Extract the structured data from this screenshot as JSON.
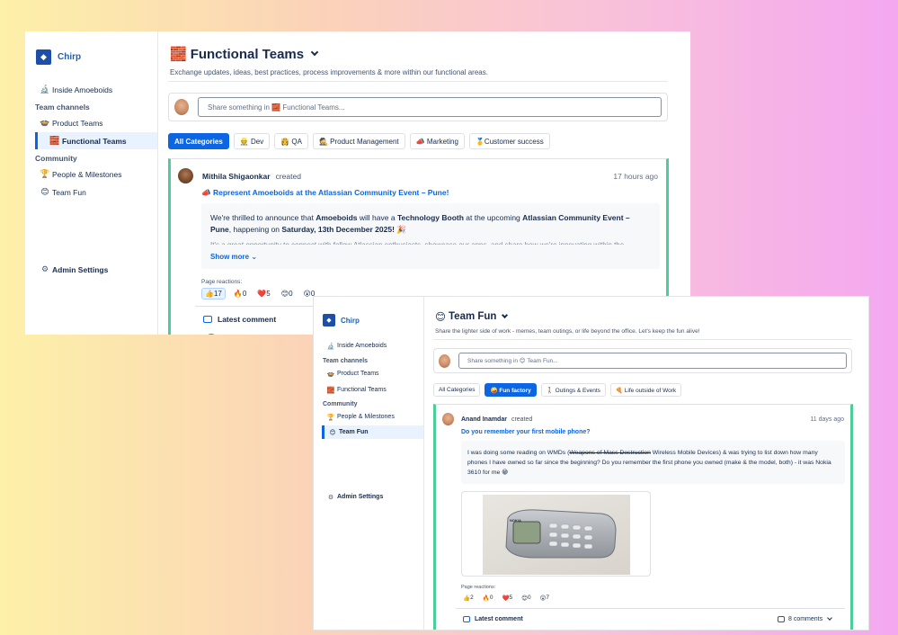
{
  "window1": {
    "brand": "Chirp",
    "sidebar": {
      "inside": {
        "icon": "🔬",
        "label": "Inside Amoeboids"
      },
      "team_channels_heading": "Team channels",
      "product_teams": {
        "icon": "🍲",
        "label": "Product Teams"
      },
      "functional_teams": {
        "icon": "🧱",
        "label": "Functional Teams"
      },
      "community_heading": "Community",
      "people": {
        "icon": "🏆",
        "label": "People & Milestones"
      },
      "team_fun": {
        "icon": "😊",
        "label": "Team Fun"
      },
      "admin": {
        "label": "Admin Settings"
      }
    },
    "page": {
      "icon": "🧱",
      "title": "Functional Teams",
      "subtitle": "Exchange updates, ideas, best practices, process improvements & more within our functional areas.",
      "share_placeholder": "Share something in 🧱 Functional Teams..."
    },
    "categories": [
      {
        "label": "All Categories"
      },
      {
        "label": "👷 Dev"
      },
      {
        "label": "👸 QA"
      },
      {
        "label": "🕵 Product Management"
      },
      {
        "label": "📣 Marketing"
      },
      {
        "label": "🥇Customer success"
      }
    ],
    "post": {
      "author": "Mithila Shigaonkar",
      "action": "created",
      "time": "17 hours ago",
      "title_icon": "📣",
      "title": "Represent Amoeboids at the Atlassian Community Event – Pune!",
      "body_1": "We're thrilled to announce that ",
      "body_b1": "Amoeboids",
      "body_2": " will have a ",
      "body_b2": "Technology Booth",
      "body_3": " at the upcoming ",
      "body_b3": "Atlassian Community Event – Pune",
      "body_4": ", happening on ",
      "body_b4": "Saturday, 13th December 2025!",
      "body_5": " 🎉",
      "body_cut": "It's a great opportunity to connect with fellow Atlassian enthusiasts, showcase our apps, and share how we're innovating within the",
      "show_more": "Show more",
      "reactions_label": "Page reactions:",
      "reactions": [
        {
          "icon": "👍",
          "count": "17"
        },
        {
          "icon": "🔥",
          "count": "0"
        },
        {
          "icon": "❤️",
          "count": "5"
        },
        {
          "icon": "😊",
          "count": "0"
        },
        {
          "icon": "😮",
          "count": "0"
        }
      ],
      "latest_comment": "Latest comment"
    }
  },
  "window2": {
    "brand": "Chirp",
    "sidebar": {
      "inside": {
        "icon": "🔬",
        "label": "Inside Amoeboids"
      },
      "team_channels_heading": "Team channels",
      "product_teams": {
        "icon": "🍲",
        "label": "Product Teams"
      },
      "functional_teams": {
        "icon": "🧱",
        "label": "Functional Teams"
      },
      "community_heading": "Community",
      "people": {
        "icon": "🏆",
        "label": "People & Milestones"
      },
      "team_fun": {
        "icon": "😊",
        "label": "Team Fun"
      },
      "admin": {
        "label": "Admin Settings"
      }
    },
    "page": {
      "icon": "😊",
      "title": "Team Fun",
      "subtitle": "Share the lighter side of work - memes, team outings, or life beyond the office. Let's keep the fun alive!",
      "share_placeholder": "Share something in 😊 Team Fun..."
    },
    "categories": [
      {
        "label": "All Categories"
      },
      {
        "label": "🤪 Fun factory"
      },
      {
        "label": "🚶 Outings & Events"
      },
      {
        "label": "🍕 Life outside of Work"
      }
    ],
    "post": {
      "author": "Anand Inamdar",
      "action": "created",
      "time": "11 days ago",
      "title": "Do you remember your first mobile phone?",
      "body_1": "I was doing some reading on WMDs (",
      "body_strike": "Weapons of Mass Destruction",
      "body_2": " Wireless Mobile Devices) & was trying to list down how many phones I have owned so far since the beginning? Do you remember the first phone you owned (make & the model, both) - it was Nokia 3610 for me 😁",
      "phone_brand": "NOKIA",
      "reactions_label": "Page reactions:",
      "reactions": [
        {
          "icon": "👍",
          "count": "2"
        },
        {
          "icon": "🔥",
          "count": "0"
        },
        {
          "icon": "❤️",
          "count": "5"
        },
        {
          "icon": "😊",
          "count": "0"
        },
        {
          "icon": "😮",
          "count": "7"
        }
      ],
      "latest_comment": "Latest comment",
      "comments": "8 comments"
    }
  }
}
